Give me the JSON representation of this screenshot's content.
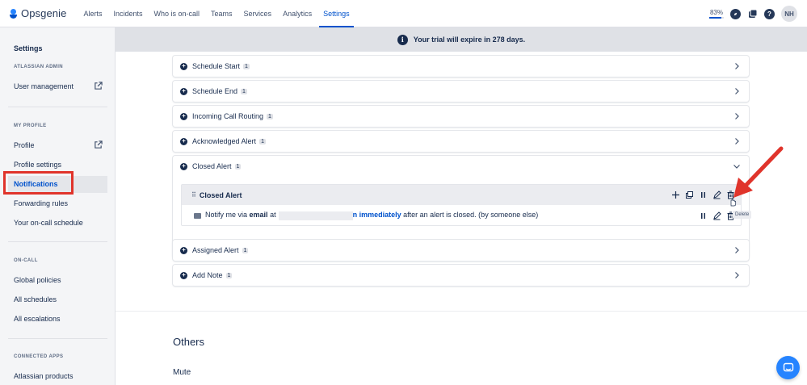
{
  "app": {
    "name": "Opsgenie"
  },
  "nav": {
    "items": [
      {
        "label": "Alerts"
      },
      {
        "label": "Incidents"
      },
      {
        "label": "Who is on-call"
      },
      {
        "label": "Teams"
      },
      {
        "label": "Services"
      },
      {
        "label": "Analytics"
      },
      {
        "label": "Settings",
        "active": true
      }
    ],
    "progress": "83%",
    "progress_fraction": 0.83,
    "icons": [
      "compass-icon",
      "app-switcher-icon",
      "help-icon"
    ],
    "avatar": "NH"
  },
  "sidebar": {
    "title": "Settings",
    "atlassian_admin": "ATLASSIAN ADMIN",
    "user_management": "User management",
    "my_profile": "MY PROFILE",
    "profile": "Profile",
    "profile_settings": "Profile settings",
    "notifications": "Notifications",
    "forwarding_rules": "Forwarding rules",
    "on_call_schedule": "Your on-call schedule",
    "on_call": "ON-CALL",
    "global_policies": "Global policies",
    "all_schedules": "All schedules",
    "all_escalations": "All escalations",
    "connected_apps": "CONNECTED APPS",
    "atlassian_products": "Atlassian products"
  },
  "banner": {
    "text": "Your trial will expire in 278 days."
  },
  "rows": [
    {
      "label": "Schedule Start",
      "count": "1"
    },
    {
      "label": "Schedule End",
      "count": "1"
    },
    {
      "label": "Incoming Call Routing",
      "count": "1"
    },
    {
      "label": "Acknowledged Alert",
      "count": "1"
    },
    {
      "label": "Closed Alert",
      "count": "1",
      "expanded": true
    },
    {
      "label": "Assigned Alert",
      "count": "1"
    },
    {
      "label": "Add Note",
      "count": "1"
    }
  ],
  "rule": {
    "title": "Closed Alert",
    "text_before": "Notify me via",
    "method": "email",
    "at": "at",
    "partial": "n",
    "timing": "immediately",
    "text_after": "after an alert is closed. (by someone else)"
  },
  "tooltip": "Delete",
  "sections": {
    "others": "Others",
    "mute": "Mute"
  },
  "colors": {
    "accent": "#0052cc",
    "highlight": "#e0342b",
    "banner": "#dfe1e6"
  }
}
